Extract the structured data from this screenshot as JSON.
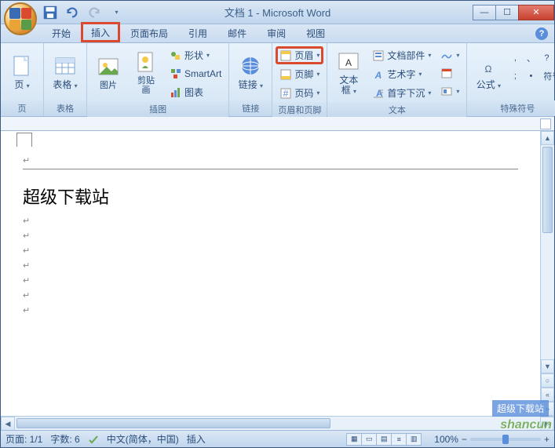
{
  "title": "文档 1 - Microsoft Word",
  "qat": {
    "save": "保存",
    "undo": "撤销",
    "redo": "重做",
    "customize": "自定义"
  },
  "tabs": {
    "home": "开始",
    "insert": "插入",
    "pagelayout": "页面布局",
    "references": "引用",
    "mail": "邮件",
    "review": "审阅",
    "view": "视图"
  },
  "ribbon": {
    "pages": {
      "label": "页",
      "group": "页"
    },
    "tables": {
      "label": "表格",
      "group": "表格"
    },
    "illustrations": {
      "picture": "图片",
      "clipart": "剪贴画",
      "shapes": "形状",
      "smartart": "SmartArt",
      "chart": "图表",
      "group": "插图"
    },
    "links": {
      "label": "链接",
      "group": "链接"
    },
    "headerfooter": {
      "header": "页眉",
      "footer": "页脚",
      "pagenum": "页码",
      "group": "页眉和页脚"
    },
    "text": {
      "textbox": "文本框",
      "quickparts": "文档部件",
      "wordart": "艺术字",
      "dropcap": "首字下沉",
      "group": "文本"
    },
    "symbols": {
      "equation": "公式",
      "symbol": "符号",
      "comma": ",",
      "semicolon": ";",
      "period": "、",
      "question": "?",
      "bullet": "•",
      "more": "符号",
      "group": "特殊符号"
    }
  },
  "document": {
    "text": "超级下载站"
  },
  "statusbar": {
    "page": "页面: 1/1",
    "words": "字数: 6",
    "lang": "中文(简体，中国)",
    "mode": "插入",
    "zoom": "100%"
  },
  "watermark": {
    "line1": "超级下载站",
    "line2": "shancun"
  }
}
